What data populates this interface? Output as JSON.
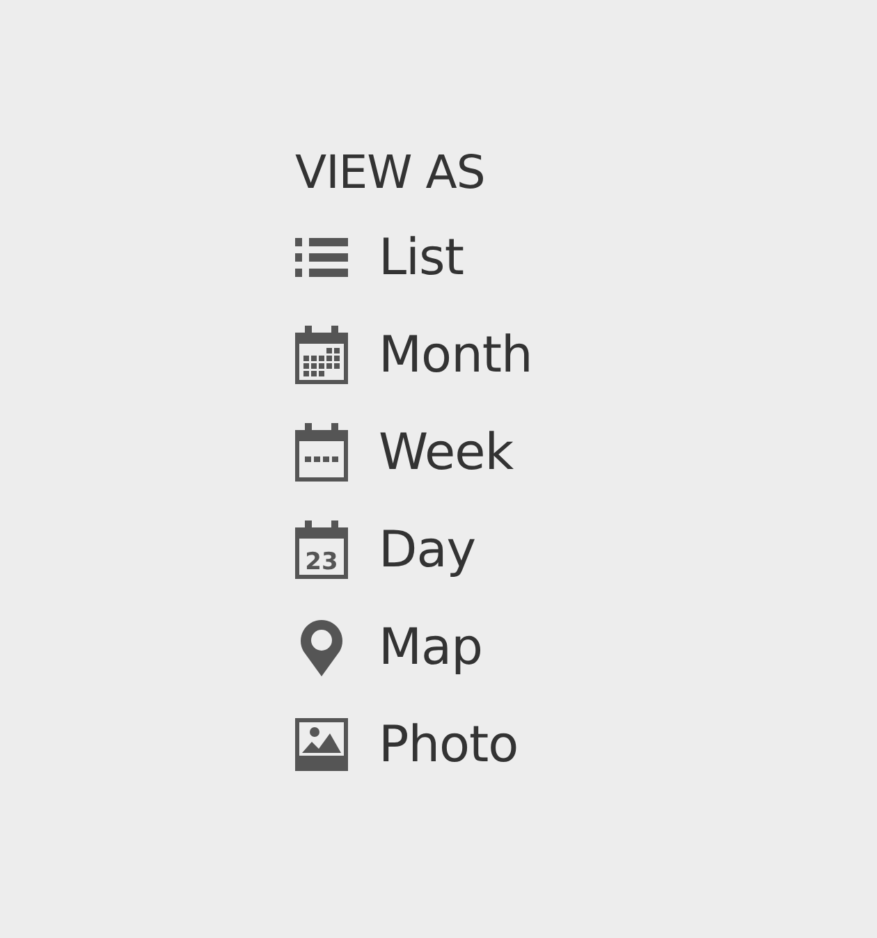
{
  "heading": "VIEW AS",
  "views": [
    {
      "kind": "list",
      "label": "List"
    },
    {
      "kind": "month",
      "label": "Month"
    },
    {
      "kind": "week",
      "label": "Week"
    },
    {
      "kind": "day",
      "label": "Day",
      "icon_text": "23"
    },
    {
      "kind": "map",
      "label": "Map"
    },
    {
      "kind": "photo",
      "label": "Photo"
    }
  ]
}
